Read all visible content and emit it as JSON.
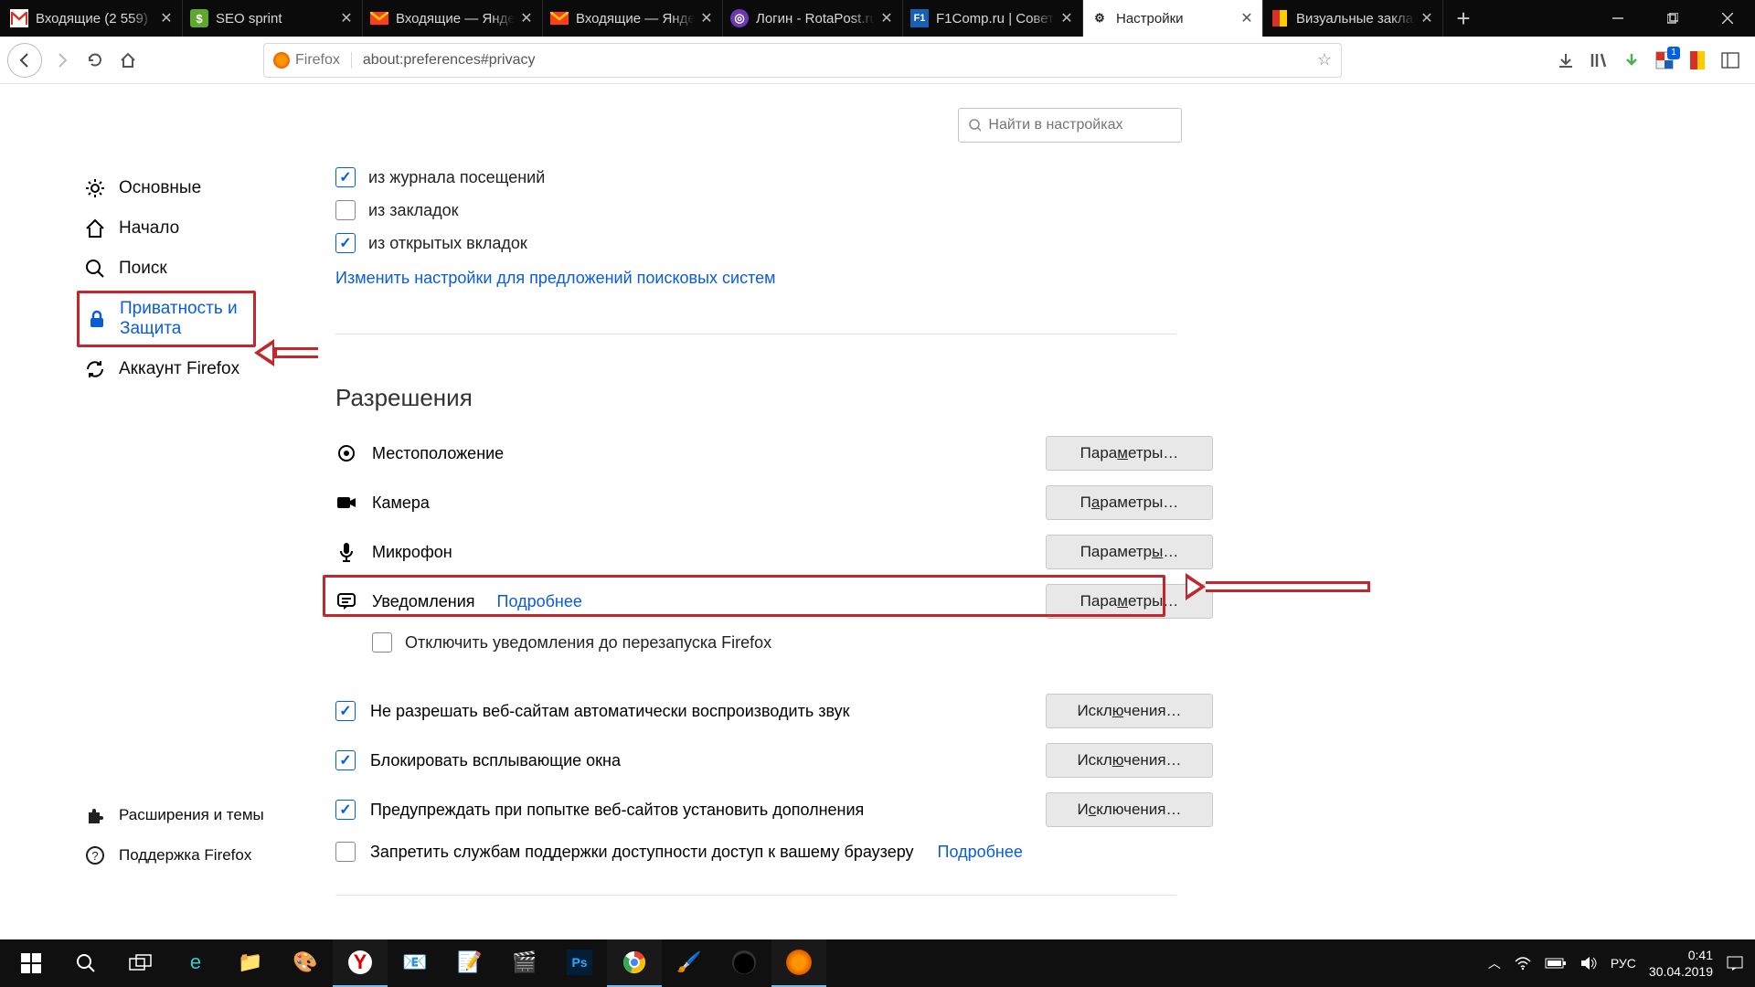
{
  "tabs": [
    {
      "label": "Входящие (2 559)",
      "active": false
    },
    {
      "label": "SEO sprint",
      "active": false
    },
    {
      "label": "Входящие — Яндек",
      "active": false
    },
    {
      "label": "Входящие — Яндек",
      "active": false
    },
    {
      "label": "Логин - RotaPost.ru",
      "active": false
    },
    {
      "label": "F1Comp.ru | Советы",
      "active": false
    },
    {
      "label": "Настройки",
      "active": true
    },
    {
      "label": "Визуальные заклад",
      "active": false
    }
  ],
  "url": {
    "identity": "Firefox",
    "value": "about:preferences#privacy"
  },
  "toolbar": {
    "badge": "1"
  },
  "search": {
    "placeholder": "Найти в настройках"
  },
  "sidebar": {
    "items": [
      {
        "label": "Основные"
      },
      {
        "label": "Начало"
      },
      {
        "label": "Поиск"
      },
      {
        "label": "Приватность и Защита"
      },
      {
        "label": "Аккаунт Firefox"
      }
    ],
    "footer": [
      {
        "label": "Расширения и темы"
      },
      {
        "label": "Поддержка Firefox"
      }
    ]
  },
  "main": {
    "checks": {
      "history": "из журнала посещений",
      "bookmarks": "из закладок",
      "opentabs": "из открытых вкладок"
    },
    "search_link": "Изменить настройки для предложений поисковых систем",
    "permissions_title": "Разрешения",
    "perms": {
      "location": "Местоположение",
      "camera": "Камера",
      "microphone": "Микрофон",
      "notifications": "Уведомления",
      "more": "Подробнее",
      "disable_until_restart": "Отключить уведомления до перезапуска Firefox",
      "autoplay": "Не разрешать веб-сайтам автоматически воспроизводить звук",
      "popups": "Блокировать всплывающие окна",
      "addons": "Предупреждать при попытке веб-сайтов установить дополнения",
      "a11y": "Запретить службам поддержки доступности доступ к вашему браузеру",
      "a11y_more": "Подробнее"
    },
    "btn_params": "Параметры…",
    "btn_excl": "Исключения…"
  },
  "tray": {
    "lang": "РУС",
    "time": "0:41",
    "date": "30.04.2019"
  }
}
